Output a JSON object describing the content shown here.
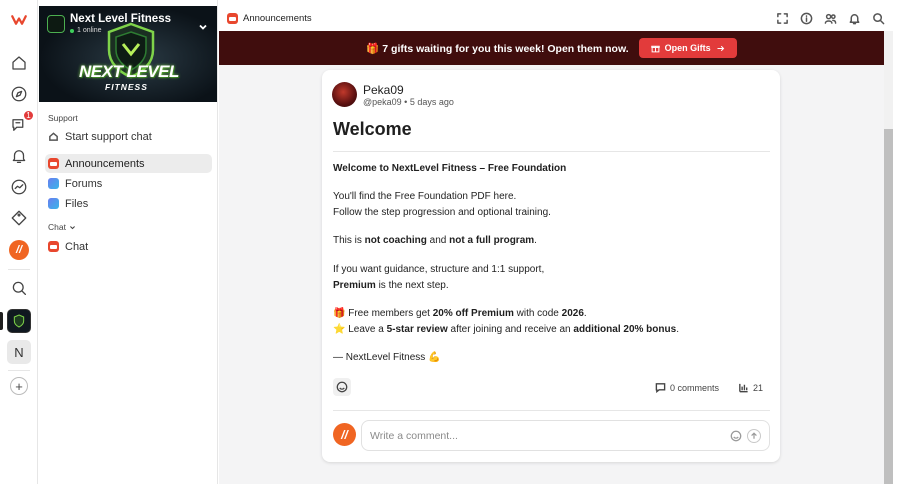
{
  "topbar": {
    "title": "Announcements"
  },
  "rail": {
    "chat_badge": "1",
    "app_letter": "N"
  },
  "community": {
    "name": "Next Level Fitness",
    "online": "1 online",
    "logo_line1": "NEXT LEVEL",
    "logo_line2": "FITNESS"
  },
  "sidebar": {
    "support_heading": "Support",
    "support_item": "Start support chat",
    "channels": [
      {
        "label": "Announcements",
        "active": true
      },
      {
        "label": "Forums",
        "active": false
      },
      {
        "label": "Files",
        "active": false
      }
    ],
    "chat_heading": "Chat",
    "chat_item": "Chat"
  },
  "promo": {
    "text": "🎁 7 gifts waiting for you this week! Open them now.",
    "button": "Open Gifts"
  },
  "post": {
    "author": "Peka09",
    "handle": "@peka09",
    "time": "5 days ago",
    "title": "Welcome",
    "lines": [
      {
        "b1": "Welcome to NextLevel Fitness – Free Foundation"
      },
      {
        "t1": "You'll find the Free Foundation PDF here."
      },
      {
        "t1": "Follow the step progression and optional training."
      },
      {
        "t1": "This is ",
        "b1": "not coaching",
        "t2": " and ",
        "b2": "not a full program",
        "t3": "."
      },
      {
        "t1": "If you want guidance, structure and 1:1 support,"
      },
      {
        "b1": "Premium",
        "t1": " is the next step."
      },
      {
        "t1": "🎁 Free members get ",
        "b1": "20% off Premium",
        "t2": " with code ",
        "b2": "2026",
        "t3": "."
      },
      {
        "t1": "⭐ Leave a ",
        "b1": "5-star review",
        "t2": " after joining and receive an ",
        "b2": "additional 20% bonus",
        "t3": "."
      },
      {
        "t1": "— NextLevel Fitness 💪"
      }
    ],
    "comments": "0 comments",
    "views": "21"
  },
  "comment": {
    "placeholder": "Write a comment..."
  },
  "colors": {
    "accent": "#e23b3b",
    "promo_bg": "#400d0d",
    "app_orange": "#f06522"
  }
}
